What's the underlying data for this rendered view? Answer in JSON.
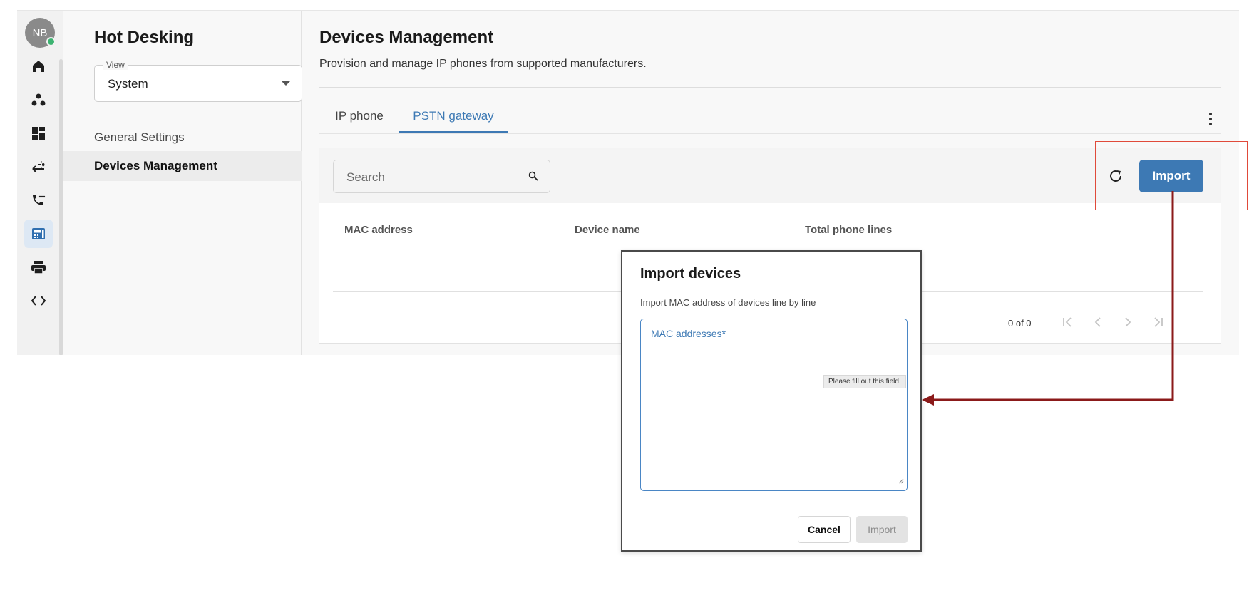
{
  "user": {
    "initials": "NB"
  },
  "rail": {
    "items": [
      {
        "icon": "home-icon"
      },
      {
        "icon": "groups-icon"
      },
      {
        "icon": "dashboard-icon"
      },
      {
        "icon": "transfer-icon"
      },
      {
        "icon": "phone-forward-icon"
      },
      {
        "icon": "desk-phone-icon",
        "active": true
      },
      {
        "icon": "printer-icon"
      },
      {
        "icon": "code-icon"
      }
    ]
  },
  "sidenav": {
    "title": "Hot Desking",
    "view_label": "View",
    "view_value": "System",
    "items": [
      {
        "label": "General Settings"
      },
      {
        "label": "Devices Management",
        "selected": true
      }
    ]
  },
  "main": {
    "title": "Devices Management",
    "subtitle": "Provision and manage IP phones from supported manufacturers.",
    "tabs": [
      {
        "label": "IP phone"
      },
      {
        "label": "PSTN gateway",
        "active": true
      }
    ],
    "search_placeholder": "Search",
    "import_label": "Import",
    "columns": [
      "MAC address",
      "Device name",
      "Total phone lines"
    ],
    "pagination": "0 of 0"
  },
  "modal": {
    "title": "Import devices",
    "description": "Import MAC address of devices line by line",
    "field_label": "MAC addresses*",
    "tooltip": "Please fill out this field.",
    "cancel_label": "Cancel",
    "import_label": "Import"
  },
  "colors": {
    "accent": "#3d79b4",
    "highlight": "#e04a3a",
    "arrow": "#8b1a1a",
    "online": "#3cb371"
  }
}
